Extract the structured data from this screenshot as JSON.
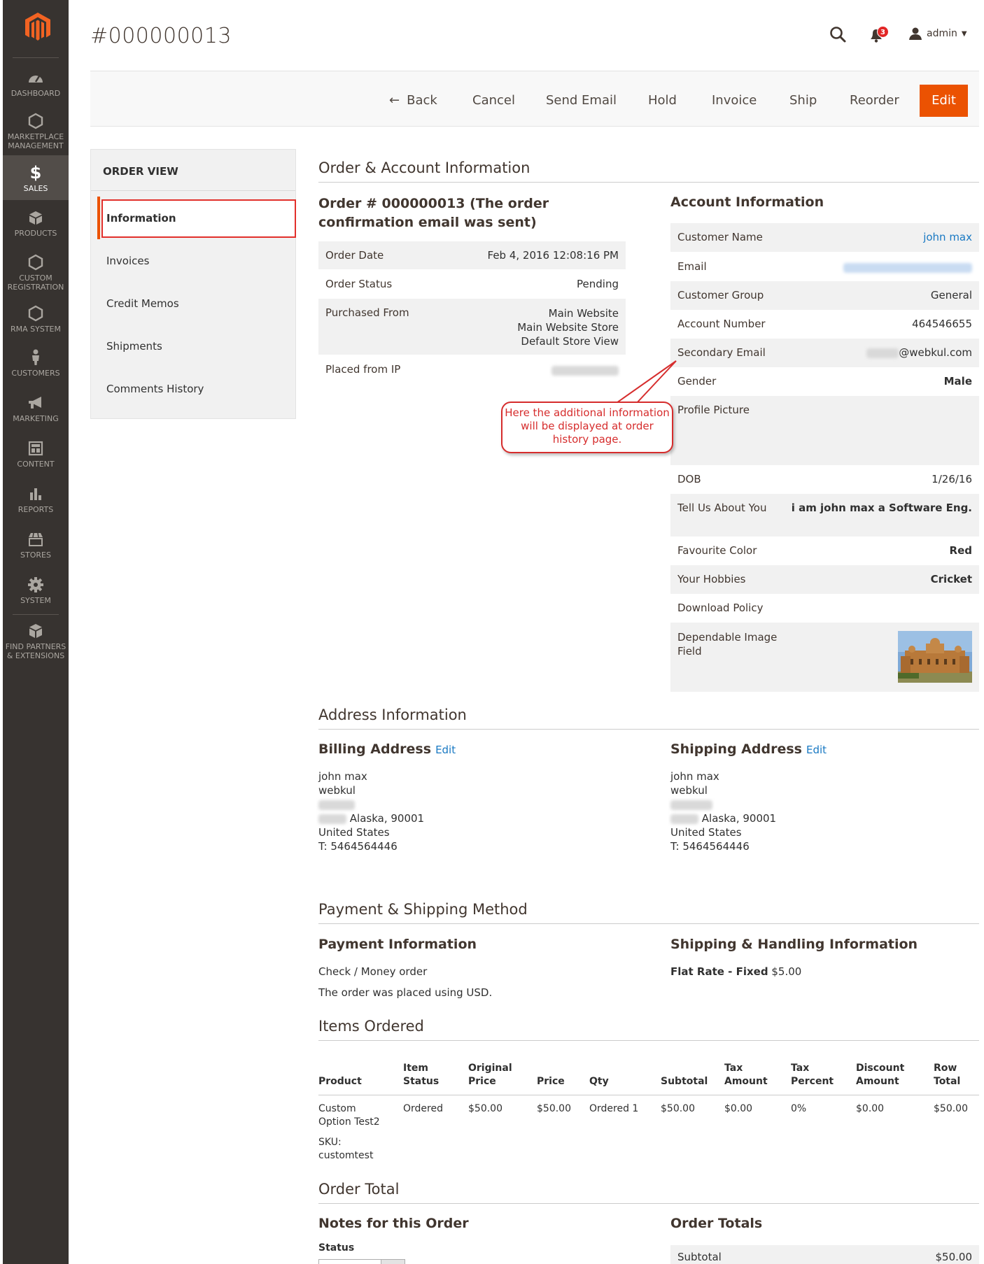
{
  "page": {
    "title": "#000000013"
  },
  "header": {
    "notification_count": "3",
    "user": "admin"
  },
  "sidebar": {
    "items": [
      {
        "label": "DASHBOARD",
        "icon": "dashboard-icon"
      },
      {
        "label": "MARKETPLACE MANAGEMENT",
        "icon": "hexagon-icon"
      },
      {
        "label": "SALES",
        "icon": "dollar-icon"
      },
      {
        "label": "PRODUCTS",
        "icon": "cube-icon"
      },
      {
        "label": "CUSTOM REGISTRATION",
        "icon": "hexagon-icon"
      },
      {
        "label": "RMA SYSTEM",
        "icon": "hexagon-icon"
      },
      {
        "label": "CUSTOMERS",
        "icon": "person-icon"
      },
      {
        "label": "MARKETING",
        "icon": "megaphone-icon"
      },
      {
        "label": "CONTENT",
        "icon": "layout-icon"
      },
      {
        "label": "REPORTS",
        "icon": "bar-chart-icon"
      },
      {
        "label": "STORES",
        "icon": "storefront-icon"
      },
      {
        "label": "SYSTEM",
        "icon": "gear-icon"
      },
      {
        "label": "FIND PARTNERS & EXTENSIONS",
        "icon": "boxes-icon"
      }
    ]
  },
  "toolbar": {
    "back": "Back",
    "cancel": "Cancel",
    "send_email": "Send Email",
    "hold": "Hold",
    "invoice": "Invoice",
    "ship": "Ship",
    "reorder": "Reorder",
    "edit": "Edit"
  },
  "tabs": {
    "title": "ORDER VIEW",
    "items": [
      "Information",
      "Invoices",
      "Credit Memos",
      "Shipments",
      "Comments History"
    ]
  },
  "order_account": {
    "section_title": "Order & Account Information",
    "order_heading": "Order # 000000013 (The order confirmation email was sent)",
    "order_rows": [
      {
        "label": "Order Date",
        "value": "Feb 4, 2016 12:08:16 PM"
      },
      {
        "label": "Order Status",
        "value": "Pending"
      },
      {
        "label": "Purchased From",
        "value": [
          "Main Website",
          "Main Website Store",
          "Default Store View"
        ]
      },
      {
        "label": "Placed from IP",
        "value": ""
      }
    ],
    "account_heading": "Account Information",
    "account_rows": [
      {
        "label": "Customer Name",
        "value": "john max"
      },
      {
        "label": "Email",
        "value": ""
      },
      {
        "label": "Customer Group",
        "value": "General"
      },
      {
        "label": "Account Number",
        "value": "464546655"
      },
      {
        "label": "Secondary Email",
        "value": "@webkul.com"
      },
      {
        "label": "Gender",
        "value": "Male"
      },
      {
        "label": "Profile Picture",
        "value": ""
      },
      {
        "label": "DOB",
        "value": "1/26/16"
      },
      {
        "label": "Tell Us About You",
        "value": "i am john max a Software Eng."
      },
      {
        "label": "Favourite Color",
        "value": "Red"
      },
      {
        "label": "Your Hobbies",
        "value": "Cricket"
      },
      {
        "label": "Download Policy",
        "value": ""
      },
      {
        "label": "Dependable Image Field",
        "value": ""
      }
    ],
    "callout": "Here the additional information will be displayed at order history page."
  },
  "address": {
    "section_title": "Address Information",
    "billing_heading": "Billing Address",
    "shipping_heading": "Shipping Address",
    "edit_label": "Edit",
    "billing_lines": [
      "john max",
      "webkul",
      "",
      "Alaska, 90001",
      "United States",
      "T: 5464564446"
    ],
    "shipping_lines": [
      "john max",
      "webkul",
      "",
      "Alaska, 90001",
      "United States",
      "T: 5464564446"
    ]
  },
  "payment": {
    "section_title": "Payment & Shipping Method",
    "payment_heading": "Payment Information",
    "payment_method": "Check / Money order",
    "currency_note": "The order was placed using USD.",
    "shipping_heading": "Shipping & Handling Information",
    "shipping_method": "Flat Rate - Fixed",
    "shipping_price": "$5.00"
  },
  "items": {
    "section_title": "Items Ordered",
    "headers": [
      "Product",
      "Item Status",
      "Original Price",
      "Price",
      "Qty",
      "Subtotal",
      "Tax Amount",
      "Tax Percent",
      "Discount Amount",
      "Row Total"
    ],
    "row": {
      "product": "Custom Option Test2",
      "sku_label": "SKU:",
      "sku": "customtest",
      "status": "Ordered",
      "original_price": "$50.00",
      "price": "$50.00",
      "qty": "Ordered 1",
      "subtotal": "$50.00",
      "tax_amount": "$0.00",
      "tax_percent": "0%",
      "discount": "$0.00",
      "row_total": "$50.00"
    }
  },
  "order_total": {
    "section_title": "Order Total",
    "notes_heading": "Notes for this Order",
    "status_label": "Status",
    "totals_heading": "Order Totals",
    "subtotal_label": "Subtotal",
    "subtotal_value": "$50.00"
  }
}
